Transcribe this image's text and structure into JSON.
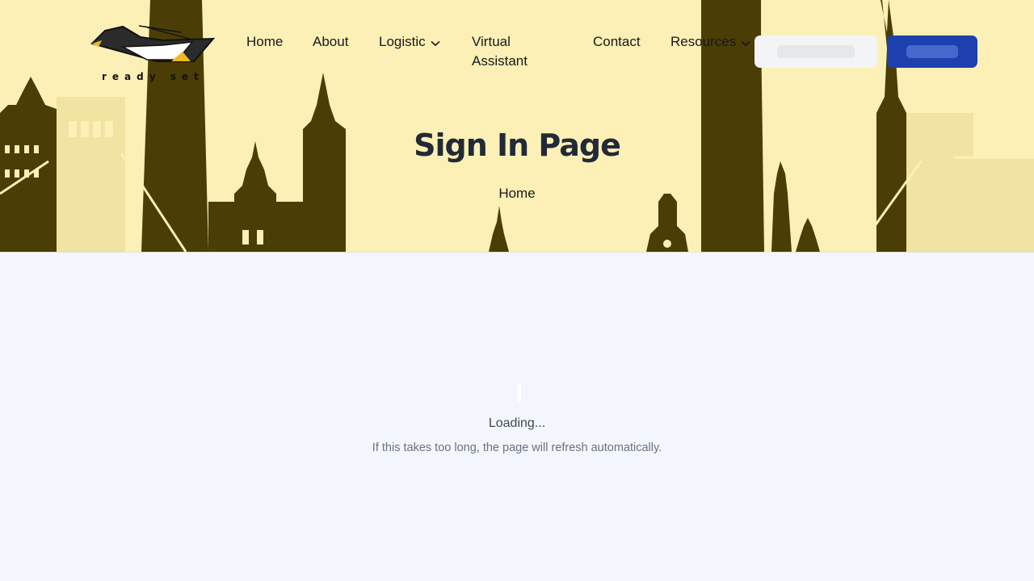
{
  "brand": {
    "logo_text": "ready set"
  },
  "nav": {
    "items": [
      {
        "label": "Home"
      },
      {
        "label": "About"
      },
      {
        "label": "Logistic",
        "has_dropdown": true
      },
      {
        "label": "Virtual Assistant"
      },
      {
        "label": "Contact"
      },
      {
        "label": "Resources",
        "has_dropdown": true
      }
    ]
  },
  "header_buttons": {
    "primary_color": "#1d40ae",
    "secondary_color": "#f3f4f6"
  },
  "hero": {
    "title": "Sign In Page",
    "breadcrumb": "Home",
    "background_color": "#fdf0b6",
    "skyline_color": "#4a3d05"
  },
  "status": {
    "loading": "Loading...",
    "hint": "If this takes too long, the page will refresh automatically."
  }
}
